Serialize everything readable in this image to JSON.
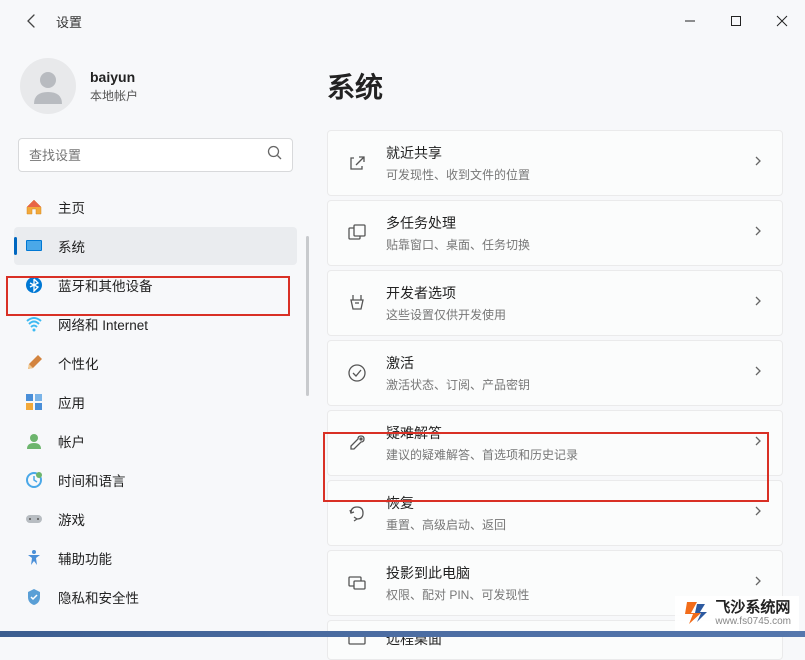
{
  "window": {
    "title": "设置"
  },
  "profile": {
    "name": "baiyun",
    "sub": "本地帐户"
  },
  "search": {
    "placeholder": "查找设置"
  },
  "nav": [
    {
      "label": "主页"
    },
    {
      "label": "系统"
    },
    {
      "label": "蓝牙和其他设备"
    },
    {
      "label": "网络和 Internet"
    },
    {
      "label": "个性化"
    },
    {
      "label": "应用"
    },
    {
      "label": "帐户"
    },
    {
      "label": "时间和语言"
    },
    {
      "label": "游戏"
    },
    {
      "label": "辅助功能"
    },
    {
      "label": "隐私和安全性"
    }
  ],
  "main": {
    "title": "系统",
    "cards": [
      {
        "title": "就近共享",
        "sub": "可发现性、收到文件的位置"
      },
      {
        "title": "多任务处理",
        "sub": "贴靠窗口、桌面、任务切换"
      },
      {
        "title": "开发者选项",
        "sub": "这些设置仅供开发使用"
      },
      {
        "title": "激活",
        "sub": "激活状态、订阅、产品密钥"
      },
      {
        "title": "疑难解答",
        "sub": "建议的疑难解答、首选项和历史记录"
      },
      {
        "title": "恢复",
        "sub": "重置、高级启动、返回"
      },
      {
        "title": "投影到此电脑",
        "sub": "权限、配对 PIN、可发现性"
      },
      {
        "title": "远程桌面",
        "sub": ""
      }
    ]
  },
  "watermark": {
    "title": "飞沙系统网",
    "url": "www.fs0745.com"
  }
}
